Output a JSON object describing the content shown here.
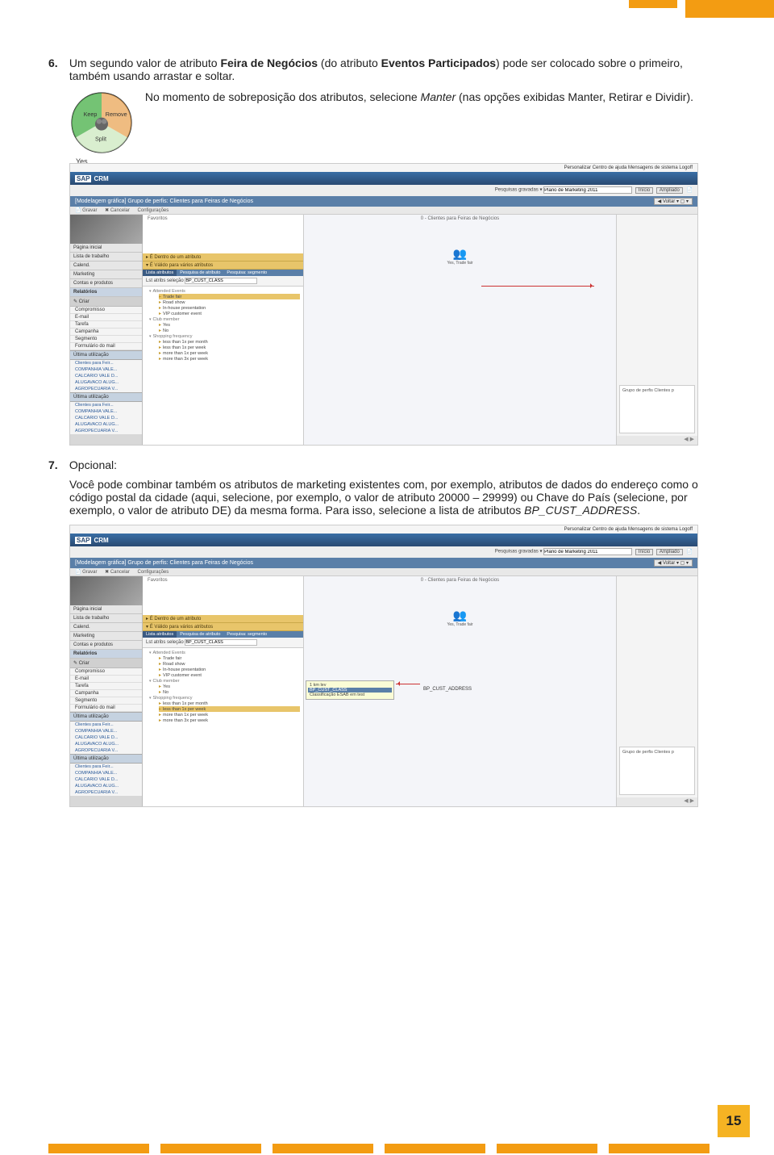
{
  "page_number": "15",
  "step6": {
    "num": "6.",
    "text_a": "Um segundo valor de atributo ",
    "bold_a": "Feira de Negócios",
    "text_b": " (do atributo ",
    "bold_b": "Eventos Participados",
    "text_c": ") pode ser colocado sobre o primeiro, também usando arrastar e soltar.",
    "overlay_a": "No momento de sobreposição dos atributos, selecione ",
    "overlay_i": "Manter",
    "overlay_b": " (nas opções exibidas Manter, Retirar e Dividir).",
    "circle": {
      "keep": "Keep",
      "remove": "Remove",
      "split": "Split",
      "yes": "Yes"
    }
  },
  "step7": {
    "num": "7.",
    "opt": "Opcional:",
    "para_a": "Você pode combinar também os atributos de marketing existentes com, por exemplo, atributos de dados do endereço como o código postal da cidade (aqui, selecione, por exemplo, o valor de atributo 20000 – 29999) ou Chave do País (selecione, por exemplo, o valor de atributo DE) da mesma forma. Para isso, selecione a lista de atributos ",
    "para_i": "BP_CUST_ADDRESS",
    "para_b": "."
  },
  "sap": {
    "logo_sap": "SAP",
    "logo_crm": "CRM",
    "top_links": "Personalizar   Centro de ajuda   Mensagens de sistema   Logoff",
    "search_label": "Pesquisas gravadas ▾",
    "search_val": "Plano de Marketing 2011",
    "btn_inicio": "Início",
    "btn_ampliado": "Ampliado",
    "page_title": "[Modelagem gráfica] Grupo de perfis: Clientes para Feiras de Negócios",
    "voltar": "◀ Voltar ▾ ▢ ▾",
    "tb_gravar": "Gravar",
    "tb_cancelar": "✖ Cancelar",
    "tb_config": "Configurações",
    "favoritos": "Favoritos",
    "canvas_title": "0 - Clientes para Feiras de Negócios",
    "node_label": "Yes, Trade fair",
    "nav": {
      "i1": "Página inicial",
      "i2": "Lista de trabalho",
      "i3": "Calend.",
      "i4": "Marketing",
      "i5": "Contas e produtos",
      "i6": "Relatórios",
      "criar": "Criar",
      "s1": "Compromisso",
      "s2": "E-mail",
      "s3": "Tarefa",
      "s4": "Campanha",
      "s5": "Segmento",
      "s6": "Formulário do mail",
      "ut": "Última utilização",
      "u1": "Clientes para Feir...",
      "u2": "COMPANHIA VALE...",
      "u3": "CALCARIO VALE D...",
      "u4": "ALUGAVACO ALUG...",
      "u5": "AGROPECUARIA V..."
    },
    "attr": {
      "g1": "É Dentro de um atributo",
      "g2": "É Válido para vários atributos",
      "t1": "Lista atributos",
      "t2": "Pesquisa de atributo",
      "t3": "Pesquisa: segmento",
      "sel_label": "Lst atribs seleção",
      "sel_val1": "BP_CUST_CLASS",
      "sel_val2": "BP_CUST_CLASS",
      "tree": {
        "h1": "Attended Events",
        "i1": "Trade fair",
        "i2": "Road show",
        "i3": "In-house presentation",
        "i4": "VIP customer event",
        "h2": "Club member",
        "i5": "Yes",
        "i6": "No",
        "h3": "Shopping frequency",
        "i7": "less than 1x per month",
        "i8": "less than 1x per week",
        "i9": "more than 1x per week",
        "i10": "more than 3x per week"
      },
      "dd": {
        "r1": "1 km lev",
        "r2": "BP_CUST_CLASS",
        "r3": "Classificação ESAB em test"
      },
      "dd_label": "BP_CUST_ADDRESS"
    },
    "side_info": "Grupo de perfis Clientes p"
  }
}
